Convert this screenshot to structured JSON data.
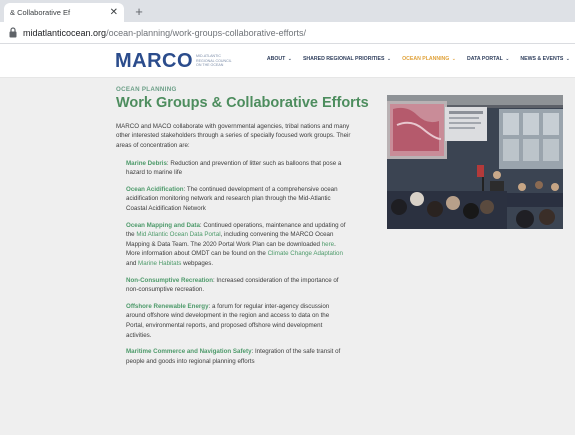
{
  "browser": {
    "tab_title": "& Collaborative Ef",
    "close_glyph": "✕",
    "new_tab_glyph": "+",
    "url_domain": "midatlanticocean.org",
    "url_path": "/ocean-planning/work-groups-collaborative-efforts/"
  },
  "header": {
    "logo_text": "MARCO",
    "logo_tagline": "Mid-Atlantic Regional Council on the Ocean",
    "nav": [
      {
        "label": "About",
        "caret": "⌄"
      },
      {
        "label": "Shared Regional Priorities",
        "caret": "⌄"
      },
      {
        "label": "Ocean Planning",
        "caret": "⌄"
      },
      {
        "label": "Data Portal",
        "caret": "⌄"
      },
      {
        "label": "News & Events",
        "caret": "⌄"
      }
    ]
  },
  "main": {
    "section_label": "Ocean Planning",
    "title": "Work Groups & Collaborative Efforts",
    "intro": "MARCO and MACO collaborate with governmental agencies, tribal nations and many other interested stakeholders through a series of specially focused work groups. Their areas of concentration are:",
    "areas": [
      {
        "term": "Marine Debris",
        "text": ": Reduction and prevention of litter such as balloons that pose a hazard to marine life"
      },
      {
        "term": "Ocean Acidification",
        "text": ": The continued development of a comprehensive ocean acidification monitoring network and research plan through the Mid-Atlantic Coastal Acidification Network"
      },
      {
        "term": "Ocean Mapping and Data",
        "text_a": ": Continued operations, maintenance and updating of the ",
        "link_a": "Mid Atlantic Ocean Data Portal",
        "text_b": ", including convening the MARCO Ocean Mapping & Data Team. The 2020 Portal Work Plan can be downloaded ",
        "link_b": "here",
        "text_c": ". More information about OMDT can be found on the ",
        "link_c": "Climate Change Adaptation",
        "text_d": " and ",
        "link_d": "Marine Habitats",
        "text_e": " webpages."
      },
      {
        "term": "Non-Consumptive Recreation",
        "text": ": Increased consideration of the importance of non-consumptive recreation."
      },
      {
        "term": "Offshore Renewable Energy",
        "text": ": a forum for regular inter-agency discussion around offshore wind development in the region and access to data on the Portal, environmental reports, and proposed offshore wind development activities."
      },
      {
        "term": "Maritime Commerce and Navigation Safety",
        "text": ": Integration of the safe transit of people and goods into regional planning efforts"
      }
    ]
  }
}
